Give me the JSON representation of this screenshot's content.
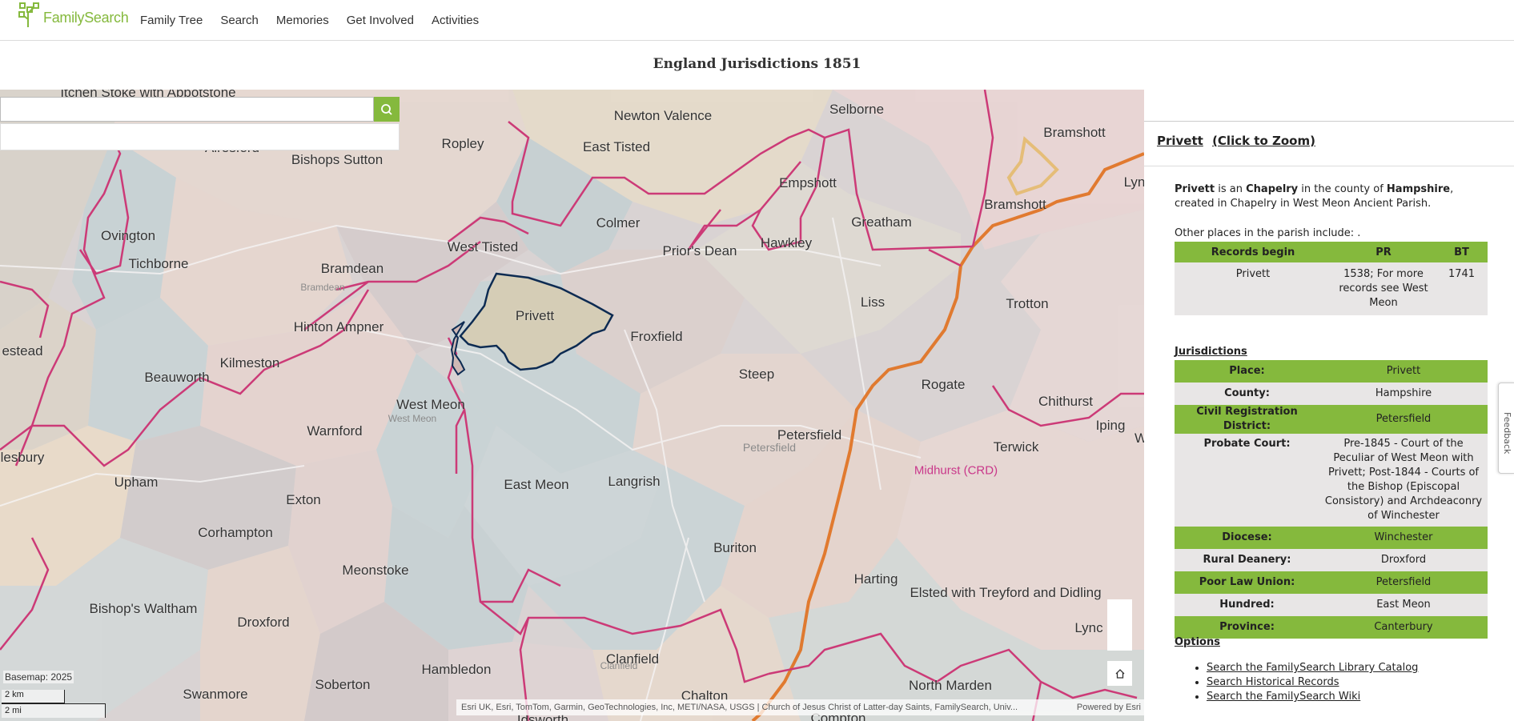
{
  "header": {
    "logo_text": "FamilySearch",
    "nav": [
      "Family Tree",
      "Search",
      "Memories",
      "Get Involved",
      "Activities"
    ]
  },
  "page_title": "England Jurisdictions 1851",
  "map": {
    "search": {
      "value": "",
      "placeholder": ""
    },
    "basemap_label": "Basemap: 2025",
    "scale_km": "2 km",
    "scale_mi": "2 mi",
    "attribution": "Esri UK, Esri, TomTom, Garmin, GeoTechnologies, Inc, METI/NASA, USGS | Church of Jesus Christ of Latter-day Saints, FamilySearch, Univ...",
    "attribution_powered": "Powered by Esri",
    "colors": {
      "selected_parish": "#d4cdb8",
      "parish_border": "#cf3a78",
      "county_border": "#e06a20",
      "selected_outline": "#0d2b52"
    },
    "place_labels": [
      "Itchen Stoke with Abbotstone",
      "Ropley",
      "Newton Valence",
      "Selborne",
      "Bramshott",
      "East Tisted",
      "Alresford",
      "Bishops Sutton",
      "Empshott",
      "Bramshott",
      "Ovington",
      "Colmer",
      "Greatham",
      "Tichborne",
      "Bramdean",
      "West Tisted",
      "Prior's Dean",
      "Hawkley",
      "Privett",
      "Liss",
      "Trotton",
      "Hinton Ampner",
      "Froxfield",
      "Kilmeston",
      "Beauworth",
      "Steep",
      "Rogate",
      "West Meon",
      "Chithurst",
      "Warnford",
      "Petersfield",
      "Iping",
      "Terwick",
      "Upham",
      "East Meon",
      "Langrish",
      "Exton",
      "Corhampton",
      "Buriton",
      "Meonstoke",
      "Harting",
      "Elsted with Treyford and Didling",
      "Bishop's Waltham",
      "Droxford",
      "Clanfield",
      "Lync",
      "Hambledon",
      "Soberton",
      "Swanmore",
      "Chalton",
      "North Marden",
      "Idsworth",
      "Compton",
      "estead",
      "lesbury",
      "Lyn",
      "W"
    ],
    "faint_labels": [
      "Bramdean",
      "West Meon",
      "Petersfield",
      "Clanfield"
    ],
    "crd_label": "Midhurst (CRD)"
  },
  "panel": {
    "place_name": "Privett",
    "zoom_link": "(Click to Zoom)",
    "desc_name": "Privett",
    "desc_is": " is an ",
    "desc_type": "Chapelry",
    "desc_in": " in the county of ",
    "desc_county": "Hampshire",
    "desc_rest": ", created in Chapelry in West Meon Ancient Parish.",
    "other_places": "Other places in the parish include: .",
    "records": {
      "headers": [
        "Records begin",
        "PR",
        "BT"
      ],
      "row": [
        "Privett",
        "1538; For more records see West Meon",
        "1741"
      ]
    },
    "jurisdictions_title": "Jurisdictions",
    "jurisdictions": [
      {
        "k": "Place:",
        "v": "Privett"
      },
      {
        "k": "County:",
        "v": "Hampshire"
      },
      {
        "k": "Civil Registration District:",
        "v": "Petersfield"
      },
      {
        "k": "Probate Court:",
        "v": "Pre-1845 - Court of the Peculiar of West Meon with Privett; Post-1844 - Courts of the Bishop (Episcopal Consistory) and Archdeaconry of Winchester"
      },
      {
        "k": "Diocese:",
        "v": "Winchester"
      },
      {
        "k": "Rural Deanery:",
        "v": "Droxford"
      },
      {
        "k": "Poor Law Union:",
        "v": "Petersfield"
      },
      {
        "k": "Hundred:",
        "v": "East Meon"
      },
      {
        "k": "Province:",
        "v": "Canterbury"
      }
    ],
    "options_title": "Options",
    "options": [
      "Search the FamilySearch Library Catalog",
      "Search Historical Records",
      "Search the FamilySearch Wiki"
    ],
    "feedback": "Feedback"
  }
}
